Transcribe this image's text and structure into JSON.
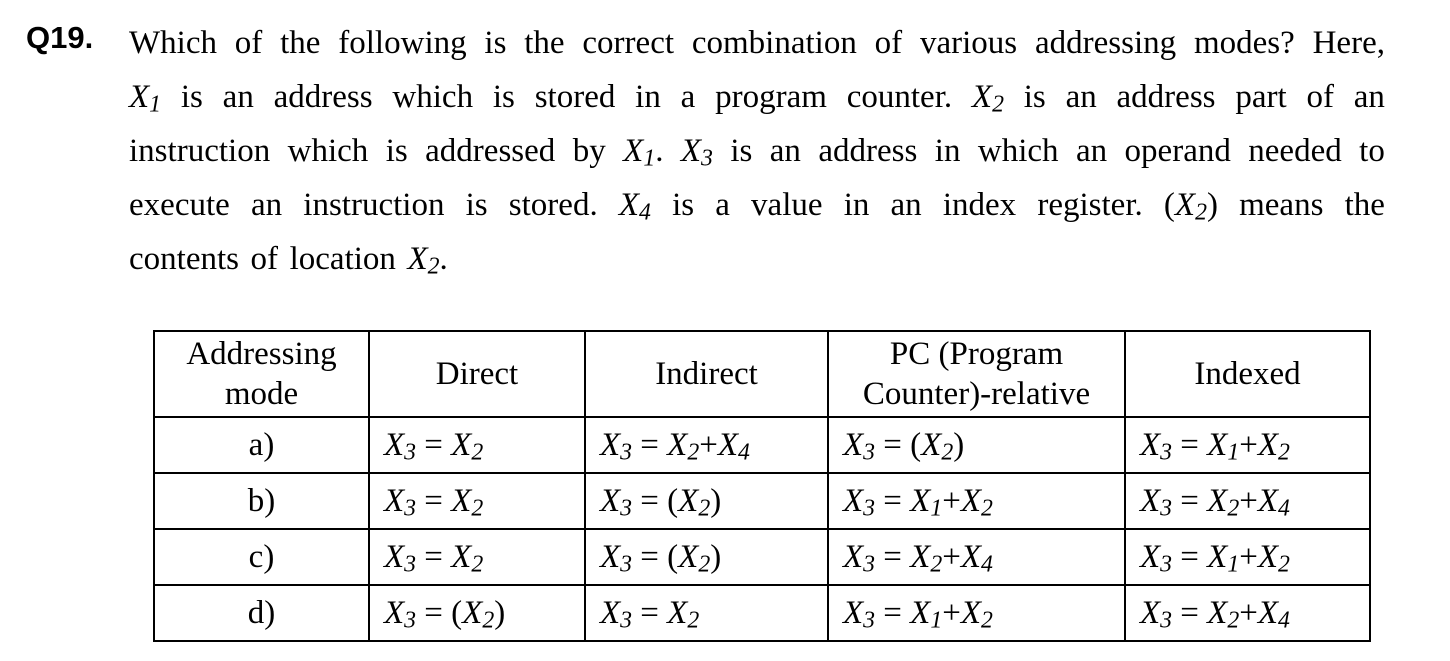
{
  "question": {
    "number": "Q19.",
    "lines": [
      [
        "Which",
        "of",
        "the",
        "following",
        "is",
        "the",
        "correct",
        "combination",
        "of",
        "various",
        "addressing",
        "modes?",
        "Here,"
      ],
      [
        "X1",
        "is",
        "an",
        "address",
        "which",
        "is",
        "stored",
        "in",
        "a",
        "program",
        "counter.",
        "X2",
        "is",
        "an",
        "address",
        "part",
        "of",
        "an"
      ],
      [
        "instruction",
        "which",
        "is",
        "addressed",
        "by",
        "X1.",
        "X3",
        "is",
        "an",
        "address",
        "in",
        "which",
        "an",
        "operand",
        "needed",
        "to"
      ],
      [
        "execute",
        "an",
        "instruction",
        "is",
        "stored.",
        "X4",
        "is",
        "a",
        "value",
        "in",
        "an",
        "index",
        "register.",
        "(X2)",
        "means",
        "the"
      ],
      [
        "contents",
        "of",
        "location",
        "X2."
      ]
    ]
  },
  "table": {
    "headers": [
      "Addressing mode",
      "Direct",
      "Indirect",
      "PC (Program Counter)-relative",
      "Indexed"
    ],
    "rows": [
      {
        "label": "a)",
        "cells": [
          "X3 = X2",
          "X3 = X2+X4",
          "X3 = (X2)",
          "X3 = X1+X2"
        ]
      },
      {
        "label": "b)",
        "cells": [
          "X3 = X2",
          "X3 = (X2)",
          "X3 = X1+X2",
          "X3 = X2+X4"
        ]
      },
      {
        "label": "c)",
        "cells": [
          "X3 = X2",
          "X3 = (X2)",
          "X3 = X2+X4",
          "X3 = X1+X2"
        ]
      },
      {
        "label": "d)",
        "cells": [
          "X3 = (X2)",
          "X3 = X2",
          "X3 = X1+X2",
          "X3 = X2+X4"
        ]
      }
    ]
  }
}
